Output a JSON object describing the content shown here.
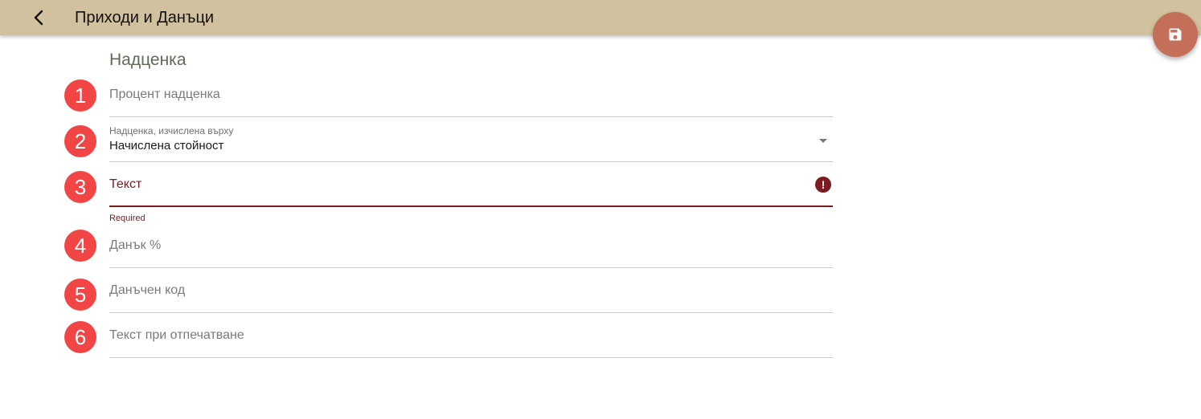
{
  "header": {
    "title": "Приходи и Данъци",
    "back_icon": "arrow-back-icon",
    "save_icon": "floppy-disk-icon",
    "bar_color": "#d1c19e",
    "fab_color": "#c46f57"
  },
  "section": {
    "title": "Надценка"
  },
  "fields": [
    {
      "number": "1",
      "placeholder": "Процент надценка"
    },
    {
      "number": "2",
      "label": "Надценка, изчислена върху",
      "value": "Начислена стойност"
    },
    {
      "number": "3",
      "placeholder": "Текст",
      "error": "Required"
    },
    {
      "number": "4",
      "placeholder": "Данък %"
    },
    {
      "number": "5",
      "placeholder": "Данъчен код"
    },
    {
      "number": "6",
      "placeholder": "Текст при отпечатване"
    }
  ],
  "colors": {
    "badge": "#f24646",
    "error": "#7d1a1f"
  }
}
